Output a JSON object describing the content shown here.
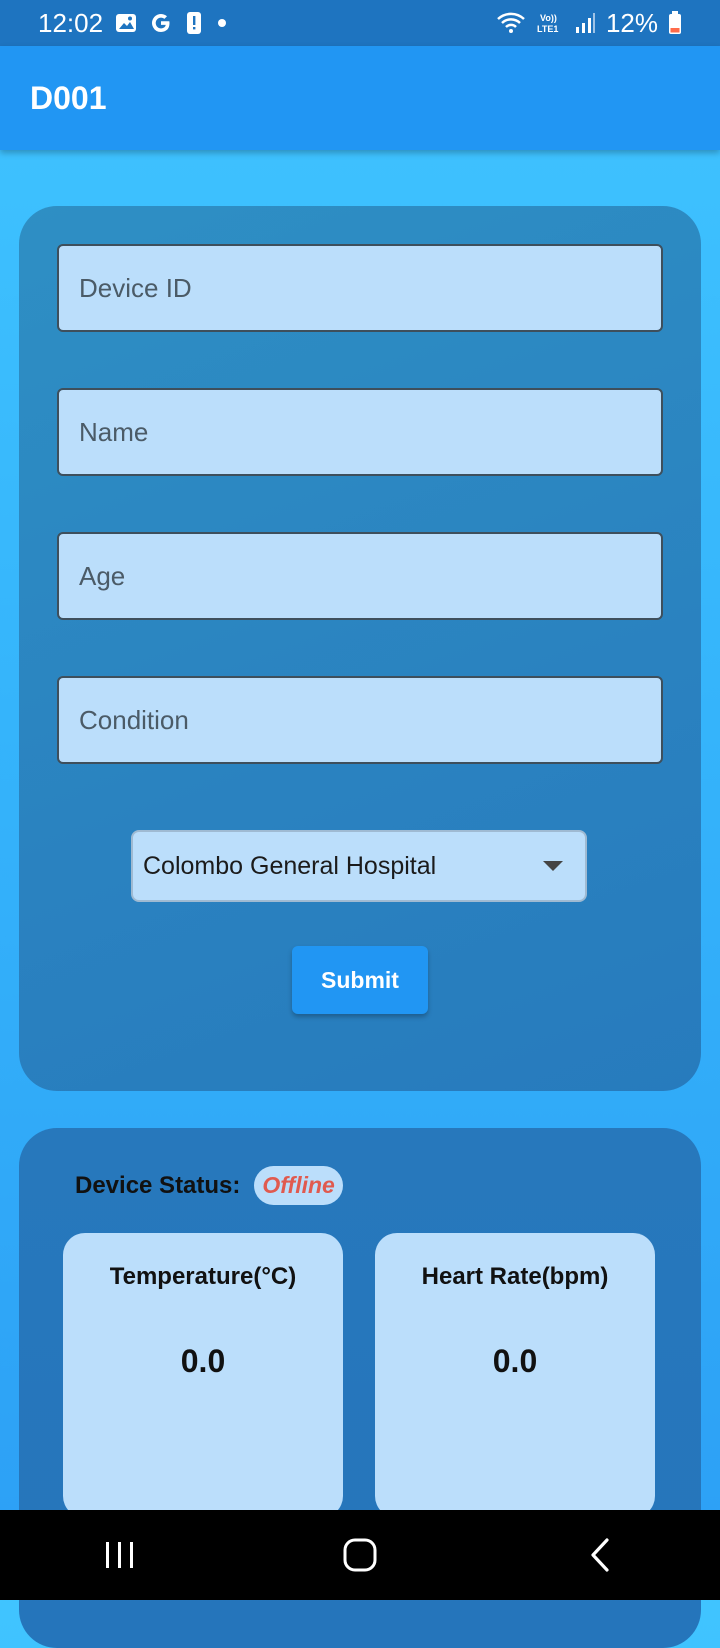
{
  "status_bar": {
    "time": "12:02",
    "battery": "12%",
    "network": "LTE1"
  },
  "app_bar": {
    "title": "D001"
  },
  "form": {
    "device_id_placeholder": "Device ID",
    "name_placeholder": "Name",
    "age_placeholder": "Age",
    "condition_placeholder": "Condition",
    "hospital_selected": "Colombo General Hospital",
    "submit_label": "Submit"
  },
  "status": {
    "label": "Device Status:",
    "value": "Offline",
    "value_color": "#e05a4f"
  },
  "metrics": [
    {
      "title": "Temperature(°C)",
      "value": "0.0"
    },
    {
      "title": "Heart Rate(bpm)",
      "value": "0.0"
    }
  ],
  "colors": {
    "app_bar": "#2196f3",
    "card": "#2a82c0",
    "field_fill": "#bbdefb",
    "button": "#2196f3"
  },
  "icons": {
    "status_left": [
      "gallery-icon",
      "google-icon",
      "alert-icon",
      "dot-icon"
    ],
    "status_right": [
      "wifi-icon",
      "volte-icon",
      "signal-icon",
      "battery-icon"
    ],
    "nav": [
      "recents-icon",
      "home-icon",
      "back-icon"
    ]
  }
}
